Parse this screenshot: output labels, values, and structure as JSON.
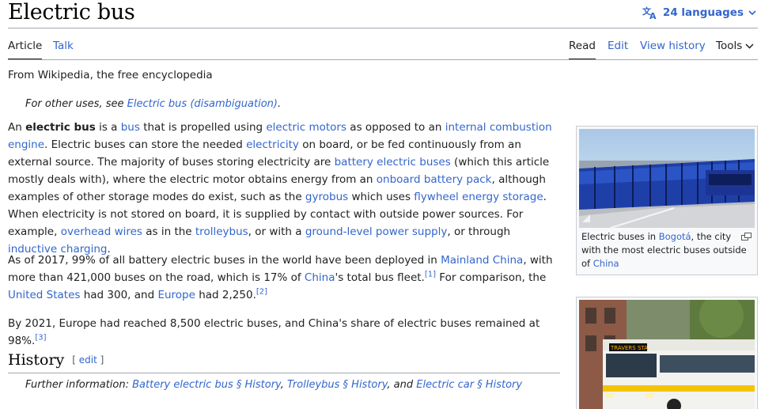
{
  "header": {
    "title": "Electric bus",
    "languages": "24 languages"
  },
  "tabs": {
    "article": "Article",
    "talk": "Talk",
    "read": "Read",
    "edit": "Edit",
    "history": "View history",
    "tools": "Tools"
  },
  "tagline": "From Wikipedia, the free encyclopedia",
  "hatnote": {
    "prefix": "For other uses, see ",
    "link": "Electric bus (disambiguation)",
    "suffix": "."
  },
  "p1": {
    "t1": "An ",
    "b1": "electric bus",
    "t2": " is a ",
    "l1": "bus",
    "t3": " that is propelled using ",
    "l2": "electric motors",
    "t4": " as opposed to an ",
    "l3": "internal combustion engine",
    "t5": ". Electric buses can store the needed ",
    "l4": "electricity",
    "t6": " on board, or be fed continuously from an external source. The majority of buses storing electricity are ",
    "l5": "battery electric buses",
    "t7": " (which this article mostly deals with), where the electric motor obtains energy from an ",
    "l6": "onboard battery pack",
    "t8": ", although examples of other storage modes do exist, such as the ",
    "l7": "gyrobus",
    "t9": " which uses ",
    "l8": "flywheel energy storage",
    "t10": ". When electricity is not stored on board, it is supplied by contact with outside power sources. For example, ",
    "l9": "overhead wires",
    "t11": " as in the ",
    "l10": "trolleybus",
    "t12": ", or with a ",
    "l11": "ground-level power supply",
    "t13": ", or through ",
    "l12": "inductive charging",
    "t14": "."
  },
  "p2": {
    "t1": "As of 2017, 99% of all battery electric buses in the world have been deployed in ",
    "l1": "Mainland China",
    "t2": ", with more than 421,000 buses on the road, which is 17% of ",
    "l2": "China",
    "t3": "'s total bus fleet.",
    "r1": "[1]",
    "t4": " For comparison, the ",
    "l3": "United States",
    "t5": " had 300, and ",
    "l4": "Europe",
    "t6": " had 2,250.",
    "r2": "[2]"
  },
  "p3": {
    "t1": "By 2021, Europe had reached 8,500 electric buses, and China's share of electric buses remained at 98%.",
    "r1": "[3]"
  },
  "history": {
    "heading": "History",
    "edit_open": "[ ",
    "edit": "edit",
    "edit_close": " ]",
    "further_prefix": "Further information: ",
    "l1": "Battery electric bus § History",
    "sep1": ", ",
    "l2": "Trolleybus § History",
    "sep2": ", and ",
    "l3": "Electric car § History"
  },
  "figure1": {
    "t1": "Electric buses in ",
    "l1": "Bogotá",
    "t2": ", the city with the most electric buses outside of ",
    "l2": "China"
  },
  "figure2": {
    "bus_sign": "TRAVERS STA"
  },
  "colors": {
    "link": "#3366cc",
    "text": "#202122",
    "bus_blue": "#1f3fa8"
  }
}
